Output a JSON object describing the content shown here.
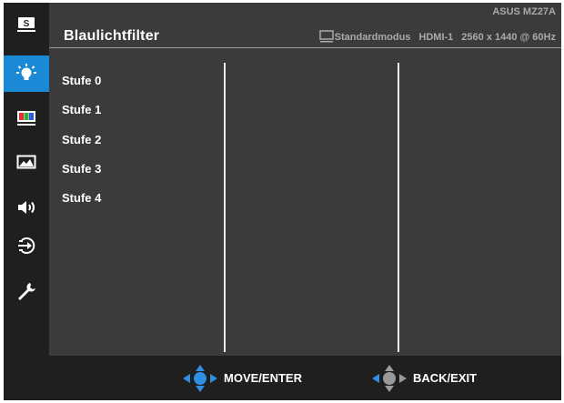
{
  "header": {
    "title": "Blaulichtfilter",
    "model": "ASUS MZ27A",
    "mode": "Standardmodus",
    "input": "HDMI-1",
    "resolution": "2560 x 1440 @ 60Hz"
  },
  "sidebar": {
    "items": [
      {
        "icon": "splendid-s-icon",
        "active": false
      },
      {
        "icon": "blue-light-filter-icon",
        "active": true
      },
      {
        "icon": "color-bars-icon",
        "active": false
      },
      {
        "icon": "image-icon",
        "active": false
      },
      {
        "icon": "sound-icon",
        "active": false
      },
      {
        "icon": "input-select-icon",
        "active": false
      },
      {
        "icon": "system-setup-wrench-icon",
        "active": false
      }
    ]
  },
  "options": [
    "Stufe 0",
    "Stufe 1",
    "Stufe 2",
    "Stufe 3",
    "Stufe 4"
  ],
  "footer": {
    "move_label": "MOVE/ENTER",
    "back_label": "BACK/EXIT"
  },
  "colors": {
    "accent": "#1b8ad6",
    "panel": "#3b3b3b",
    "sidebar": "#1f1f1f"
  }
}
